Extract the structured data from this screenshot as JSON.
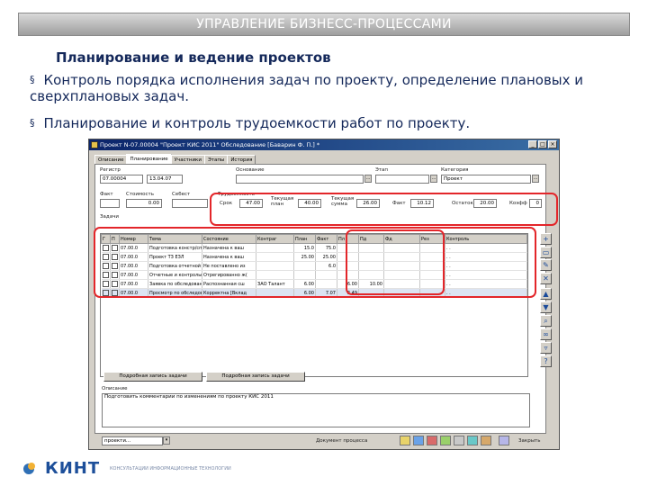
{
  "slide": {
    "banner": "УПРАВЛЕНИЕ БИЗНЕСС-ПРОЦЕССАМИ",
    "heading": "Планирование и ведение проектов",
    "bullets": [
      "Контроль порядка исполнения задач по проекту, определение плановых и сверхплановых задач.",
      "Планирование и контроль трудоемкости работ по проекту."
    ],
    "bullet_marker": "§",
    "logo_text": "КИНТ",
    "logo_tagline": "КОНСУЛЬТАЦИИ ИНФОРМАЦИОННЫЕ ТЕХНОЛОГИИ",
    "accent_color": "#e3262a",
    "text_color": "#14285a"
  },
  "window": {
    "title": "Проект N-07.00004 \"Проект КИС 2011\" Обследование [Баварин Ф. П.] *",
    "tabs": [
      "Описание",
      "Планирование",
      "Участники",
      "Этапы",
      "История"
    ],
    "active_tab": "Планирование",
    "fields": {
      "registry_label": "Регистр",
      "registry_num": "07.00004",
      "registry_date": "13.04.07",
      "basis_label": "Основание",
      "stage_label": "Этап",
      "category_label": "Категория",
      "category_value": "Проект",
      "fact_label": "Факт",
      "cost_label": "Стоимость",
      "cost_value": "0.00",
      "self_cost_label": "Себест",
      "labor_label": "Трудоемкость",
      "plan_label": "Срок",
      "plan_value": "47.00",
      "current_plan_label": "Текущая план",
      "current_plan_value": "40.00",
      "current_sum_label": "Текущая сумма",
      "current_sum_value": "26.00",
      "fact_value": "10.12",
      "rest_label": "Остаток",
      "rest_value": "20.00",
      "koef_label": "Коэфф",
      "koef_value": "0",
      "tasks_label": "Задачи"
    },
    "columns": [
      "Г",
      "П",
      "Номер",
      "Тема",
      "Состояние",
      "Контраг",
      "План",
      "Факт",
      "Пл",
      "Пд",
      "Фд",
      "Рез",
      "Контроль"
    ],
    "rows": [
      {
        "num": "07.00.0",
        "theme": "Подготовка констр/справ(Р",
        "state": "Назначена к ваш",
        "contr": "",
        "plan": "15.0",
        "fact": "75.0",
        "pl": "",
        "pd": "",
        "ctl": ". ."
      },
      {
        "num": "07.00.0",
        "theme": "Проект ТЗ ЕЗЛ",
        "state": "Назначена к ваш",
        "contr": "",
        "plan": "25.00",
        "fact": "25.00",
        "pl": "",
        "pd": "",
        "ctl": ". ."
      },
      {
        "num": "07.00.0",
        "theme": "Подготовка отчетной сбора",
        "state": "Не поставлено из",
        "contr": "",
        "plan": "",
        "fact": "6.0",
        "pl": "",
        "pd": "",
        "ctl": ". ."
      },
      {
        "num": "07.00.0",
        "theme": "Отчетные и контрольные",
        "state": "Отрегированно ж(",
        "contr": "",
        "plan": "",
        "fact": "",
        "pl": "",
        "pd": "",
        "ctl": ". ."
      },
      {
        "num": "07.00.0",
        "theme": "Заявка по обследованию",
        "state": "Распознанная сш",
        "contr": "ЗАО Талант",
        "plan": "6.00",
        "fact": "",
        "pl": "6.00",
        "pd": "10.00",
        "ctl": ". ."
      },
      {
        "num": "07.00.0",
        "theme": "Просмотр по обследованию",
        "state": "Корректна [Вклад",
        "contr": "",
        "plan": "6.00",
        "fact": "7.07",
        "pl": "3.49",
        "pd": "",
        "ctl": ". ."
      }
    ],
    "bottom_tabs": [
      "Подробная запись задачи",
      "Подробная запись задачи"
    ],
    "comment_label": "Описание",
    "comment_text": "Подготовить комментарии по изменениям по проекту КИС 2011",
    "bottom_dropdown": "проекти...",
    "doc_button": "Документ процесса",
    "close_button": "Закрыть"
  }
}
